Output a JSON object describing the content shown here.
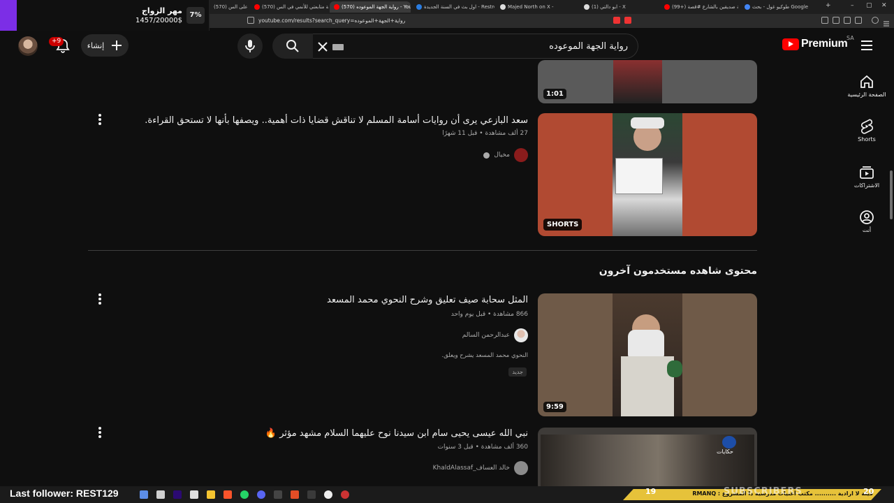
{
  "browser": {
    "tabs": [
      {
        "label": "طوكيو غول - بحث Google",
        "active": false
      },
      {
        "label": "(99+) قصة صديقين بالشارع #قصة",
        "active": false
      },
      {
        "label": "(1) ابو دالتي - X",
        "active": false
      },
      {
        "label": "Majed North on X -",
        "active": false
      },
      {
        "label": "اول بث في السنة الجديدة - Restream",
        "active": false
      },
      {
        "label": "(1) Home / X",
        "active": false
      },
      {
        "label": "(570) رواية الجهة الموعوده - You",
        "active": true
      },
      {
        "label": "(570) قصة متابعتي للأنمي في الس",
        "active": false
      },
      {
        "label": "(570) الرد على الس",
        "active": false
      }
    ],
    "url": "youtube.com/results?search_query=رواية+الجهة+الموعوده"
  },
  "donation": {
    "title": "مهر الزواج",
    "amount": "1457/20000$",
    "percent": "7%",
    "progress_fraction": 0.07
  },
  "masthead": {
    "notification_badge": "+9",
    "create_label": "إنشاء",
    "search_query": "رواية الجهة الموعوده",
    "logo_text": "Premium",
    "country_code": "SA"
  },
  "rail": [
    {
      "label": "الصفحة الرئيسية",
      "icon": "home-icon"
    },
    {
      "label": "Shorts",
      "icon": "shorts-icon"
    },
    {
      "label": "الاشتراكات",
      "icon": "subscriptions-icon"
    },
    {
      "label": "أنت",
      "icon": "you-icon"
    }
  ],
  "results": {
    "top_partial": {
      "duration": "1:01"
    },
    "video1": {
      "title": "سعد البازعي يرى أن روايات أسامة المسلم لا تناقش قضايا ذات أهمية.. ويصفها بأنها لا تستحق القراءة.",
      "meta": "27 ألف مشاهدة • قبل 11 شهرًا",
      "channel": "مخيال",
      "badge": "SHORTS"
    },
    "section_title": "محتوى شاهده مستخدمون آخرون",
    "video2": {
      "title": "المثل سحابة صيف تعليق وشرح النحوي محمد المسعد",
      "meta": "866 مشاهدة • قبل يوم واحد",
      "channel": "عبدالرحمن السالم",
      "description": "النحوي محمد المسعد يشرح ويعلق.",
      "new_badge": "جديد",
      "duration": "9:59"
    },
    "video3": {
      "title": "نبي الله عيسى يحيى سام ابن سيدنا نوح عليهما السلام مشهد مؤثر 🔥",
      "meta": "360 ألف مشاهدة • قبل 3 سنوات",
      "channel": "خالد العساف_KhaldAlassaf",
      "thumb_tag": "حكايات"
    }
  },
  "overlay": {
    "last_follower": "Last follower: REST129",
    "ticker": "فيلة لا ارادية  ..........  مكتب  أغنيات مدرسية ذا المشروع : RMANQ",
    "subs_label": "SUBSCRIBERS",
    "subs_left": "19",
    "subs_right": "20"
  },
  "colors": {
    "background": "#0f0f0f",
    "accent_purple": "#7c2ee6",
    "youtube_red": "#ff0000",
    "ticker_yellow": "#e6c23a"
  }
}
